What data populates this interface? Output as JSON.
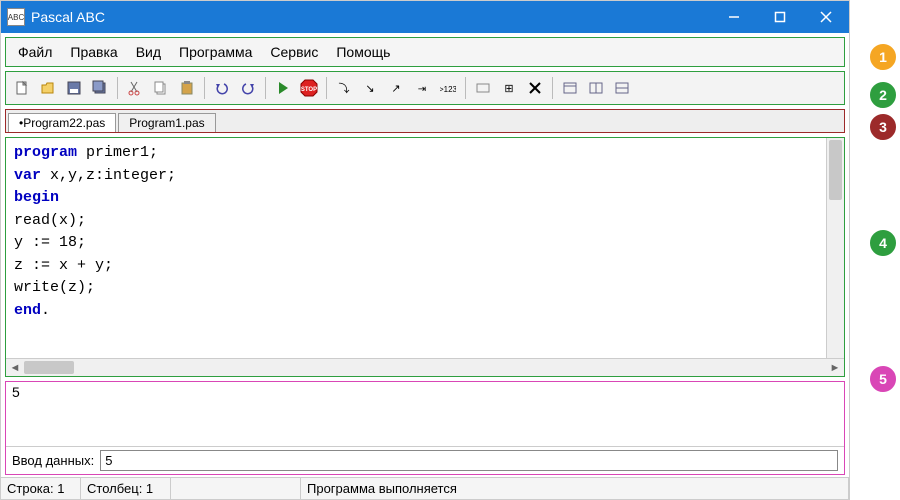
{
  "title": "Pascal ABC",
  "menu": [
    "Файл",
    "Правка",
    "Вид",
    "Программа",
    "Сервис",
    "Помощь"
  ],
  "toolbar_icons": [
    "new-file-icon",
    "open-icon",
    "save-icon",
    "save-all-icon",
    "cut-icon",
    "copy-icon",
    "paste-icon",
    "undo-icon",
    "redo-icon",
    "run-icon",
    "stop-icon",
    "step-over-icon",
    "step-into-icon",
    "step-out-icon",
    "run-to-cursor-icon",
    "add-watch-icon",
    "breakpoint-icon",
    "toggle-icon",
    "delete-icon",
    "window1-icon",
    "window2-icon",
    "window3-icon"
  ],
  "tabs": [
    {
      "label": "•Program22.pas",
      "active": true
    },
    {
      "label": "Program1.pas",
      "active": false
    }
  ],
  "code_lines": [
    [
      {
        "t": "program",
        "k": true
      },
      {
        "t": " primer1;",
        "k": false
      }
    ],
    [
      {
        "t": "var",
        "k": true
      },
      {
        "t": " x,y,z:integer;",
        "k": false
      }
    ],
    [
      {
        "t": "begin",
        "k": true
      }
    ],
    [
      {
        "t": "read(x);",
        "k": false
      }
    ],
    [
      {
        "t": "y := 18;",
        "k": false
      }
    ],
    [
      {
        "t": "z := x + y;",
        "k": false
      }
    ],
    [
      {
        "t": "write(z);",
        "k": false
      }
    ],
    [
      {
        "t": "end",
        "k": true
      },
      {
        "t": ".",
        "k": false
      }
    ]
  ],
  "output": "5",
  "input_label": "Ввод данных:",
  "input_value": "5",
  "status": {
    "line_label": "Строка: 1",
    "col_label": "Столбец: 1",
    "running": "Программа выполняется"
  },
  "badges": [
    "1",
    "2",
    "3",
    "4",
    "5"
  ]
}
